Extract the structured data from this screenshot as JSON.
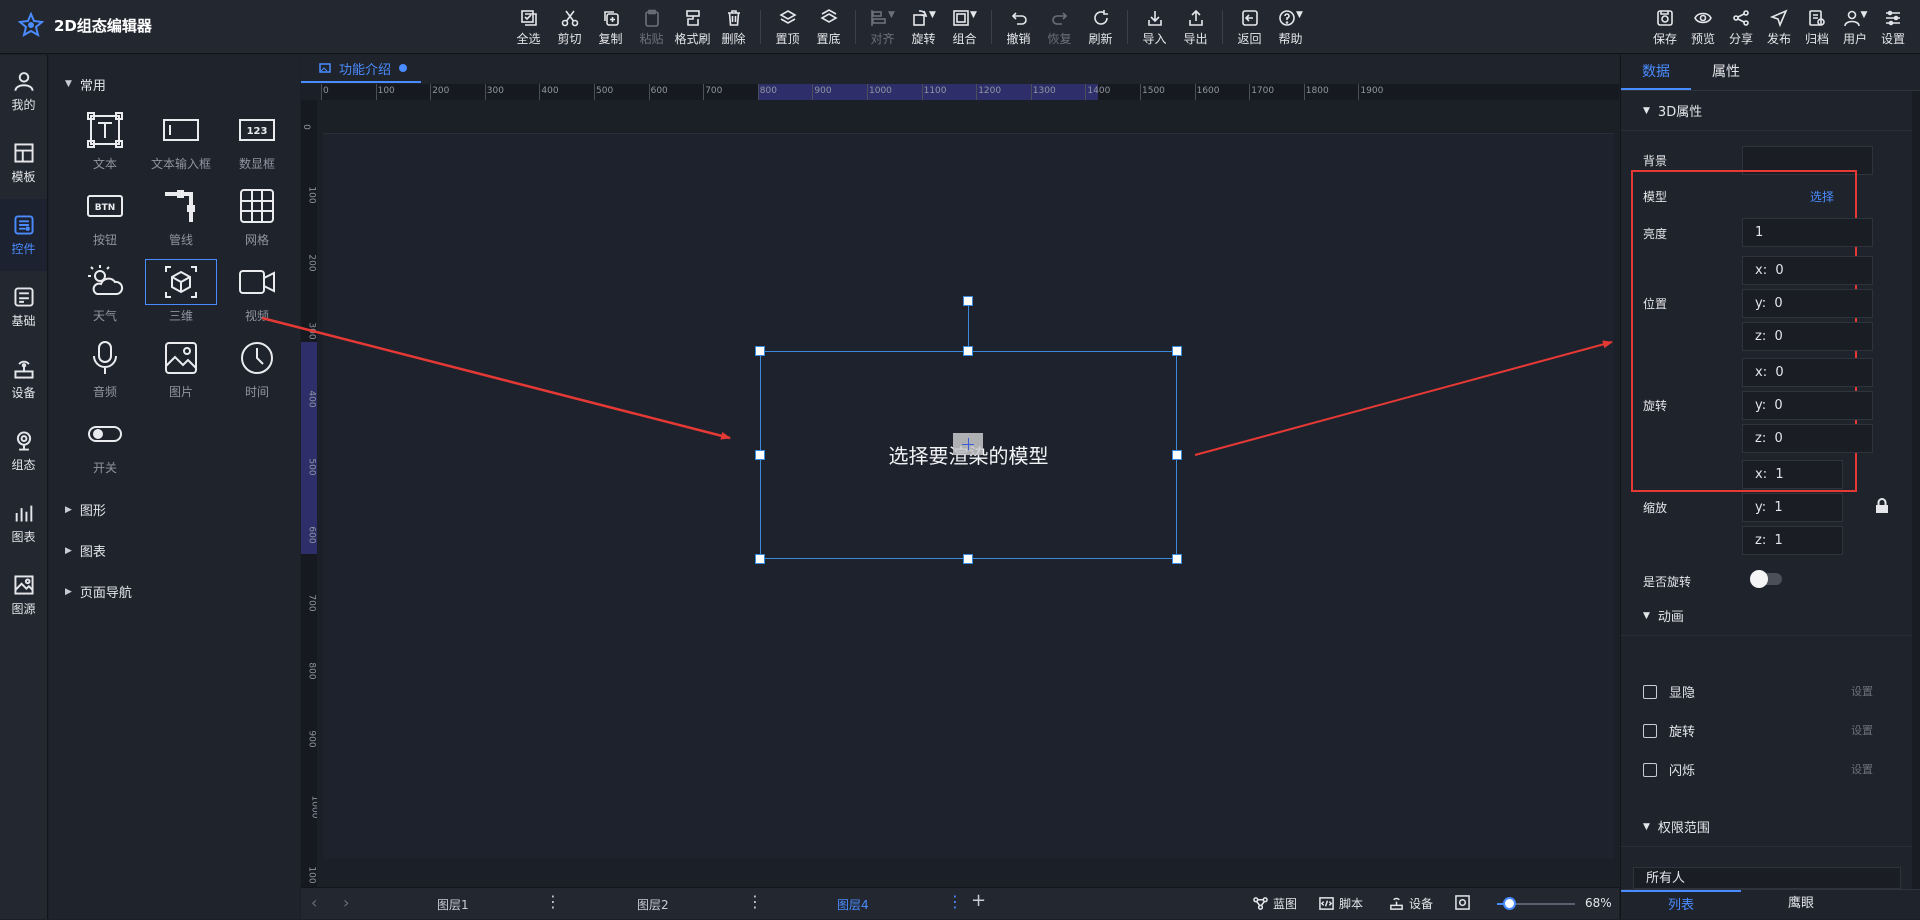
{
  "app": {
    "title": "2D组态编辑器"
  },
  "toolbar": {
    "groups": [
      [
        {
          "label": "全选",
          "icon": "select-all-icon"
        },
        {
          "label": "剪切",
          "icon": "scissors-icon"
        },
        {
          "label": "复制",
          "icon": "copy-icon"
        },
        {
          "label": "粘贴",
          "icon": "paste-icon",
          "disabled": true
        },
        {
          "label": "格式刷",
          "icon": "format-brush-icon"
        },
        {
          "label": "删除",
          "icon": "trash-icon"
        }
      ],
      [
        {
          "label": "置顶",
          "icon": "layer-top-icon"
        },
        {
          "label": "置底",
          "icon": "layer-bottom-icon"
        }
      ],
      [
        {
          "label": "对齐",
          "icon": "align-icon",
          "disabled": true,
          "caret": true
        },
        {
          "label": "旋转",
          "icon": "rotate-icon",
          "caret": true
        },
        {
          "label": "组合",
          "icon": "group-icon",
          "caret": true
        }
      ],
      [
        {
          "label": "撤销",
          "icon": "undo-icon"
        },
        {
          "label": "恢复",
          "icon": "redo-icon",
          "disabled": true
        },
        {
          "label": "刷新",
          "icon": "refresh-icon"
        }
      ],
      [
        {
          "label": "导入",
          "icon": "import-icon"
        },
        {
          "label": "导出",
          "icon": "export-icon"
        }
      ],
      [
        {
          "label": "返回",
          "icon": "back-icon"
        },
        {
          "label": "帮助",
          "icon": "help-icon",
          "caret": true
        }
      ]
    ],
    "right": [
      {
        "label": "保存",
        "icon": "save-icon"
      },
      {
        "label": "预览",
        "icon": "preview-icon"
      },
      {
        "label": "分享",
        "icon": "share-icon"
      },
      {
        "label": "发布",
        "icon": "publish-icon"
      },
      {
        "label": "归档",
        "icon": "archive-icon"
      },
      {
        "label": "用户",
        "icon": "user-icon",
        "caret": true
      },
      {
        "label": "设置",
        "icon": "settings-icon"
      }
    ]
  },
  "rail": [
    {
      "label": "我的",
      "icon": "user-icon"
    },
    {
      "label": "模板",
      "icon": "template-icon"
    },
    {
      "label": "控件",
      "icon": "widget-icon",
      "active": true
    },
    {
      "label": "基础",
      "icon": "basic-icon"
    },
    {
      "label": "设备",
      "icon": "device-icon"
    },
    {
      "label": "组态",
      "icon": "config-icon"
    },
    {
      "label": "图表",
      "icon": "chart-icon"
    },
    {
      "label": "图源",
      "icon": "image-source-icon"
    }
  ],
  "panel": {
    "common_title": "常用",
    "components": [
      {
        "label": "文本",
        "icon": "text-icon"
      },
      {
        "label": "文本输入框",
        "icon": "text-input-icon"
      },
      {
        "label": "数显框",
        "icon": "number-display-icon"
      },
      {
        "label": "按钮",
        "icon": "button-icon"
      },
      {
        "label": "管线",
        "icon": "pipeline-icon"
      },
      {
        "label": "网格",
        "icon": "grid-icon"
      },
      {
        "label": "天气",
        "icon": "weather-icon"
      },
      {
        "label": "三维",
        "icon": "3d-cube-icon",
        "selected": true
      },
      {
        "label": "视频",
        "icon": "video-icon"
      },
      {
        "label": "音频",
        "icon": "microphone-icon"
      },
      {
        "label": "图片",
        "icon": "image-icon"
      },
      {
        "label": "时间",
        "icon": "clock-icon"
      },
      {
        "label": "开关",
        "icon": "switch-icon"
      }
    ],
    "collapsed_sections": [
      "图形",
      "图表",
      "页面导航"
    ]
  },
  "canvas": {
    "tab_label": "功能介绍",
    "h_ticks": [
      "0",
      "100",
      "200",
      "300",
      "400",
      "500",
      "600",
      "700",
      "800",
      "900",
      "1000",
      "1100",
      "1200",
      "1300",
      "1400",
      "1500",
      "1600",
      "1700",
      "1800",
      "1900"
    ],
    "v_ticks": [
      "0",
      "100",
      "200",
      "300",
      "400",
      "500",
      "600",
      "700",
      "800",
      "900",
      "1000",
      "100"
    ],
    "placeholder_text": "选择要渲染的模型"
  },
  "layers": {
    "items": [
      {
        "label": "图层1"
      },
      {
        "label": "图层2"
      },
      {
        "label": "图层4",
        "active": true
      }
    ],
    "add": "+",
    "tools": [
      {
        "label": "蓝图",
        "icon": "blueprint-icon"
      },
      {
        "label": "脚本",
        "icon": "script-icon"
      },
      {
        "label": "设备",
        "icon": "device-icon"
      }
    ],
    "zoom": "68%",
    "zoom_fraction": 0.15
  },
  "props": {
    "tabs": [
      {
        "label": "数据",
        "active": true
      },
      {
        "label": "属性"
      }
    ],
    "section_3d": "3D属性",
    "background_label": "背景",
    "model_label": "模型",
    "model_action": "选择",
    "brightness_label": "亮度",
    "brightness_value": "1",
    "position_label": "位置",
    "position": {
      "x": "0",
      "y": "0",
      "z": "0"
    },
    "rotation_label": "旋转",
    "rotation": {
      "x": "0",
      "y": "0",
      "z": "0"
    },
    "scale_label": "缩放",
    "scale": {
      "x": "1",
      "y": "1",
      "z": "1"
    },
    "auto_rotate_label": "是否旋转",
    "auto_rotate": false,
    "section_anim": "动画",
    "animations": [
      {
        "label": "显隐",
        "action": "设置"
      },
      {
        "label": "旋转",
        "action": "设置"
      },
      {
        "label": "闪烁",
        "action": "设置"
      }
    ],
    "section_perm": "权限范围",
    "perm_value": "所有人",
    "bottom_tabs": [
      {
        "label": "列表",
        "active": true
      },
      {
        "label": "鹰眼"
      }
    ]
  },
  "axis_prefix": {
    "x": "x:",
    "y": "y:",
    "z": "z:"
  },
  "colors": {
    "accent": "#4a8cff",
    "annotation": "#e53935",
    "selection": "#3b8ad9"
  }
}
